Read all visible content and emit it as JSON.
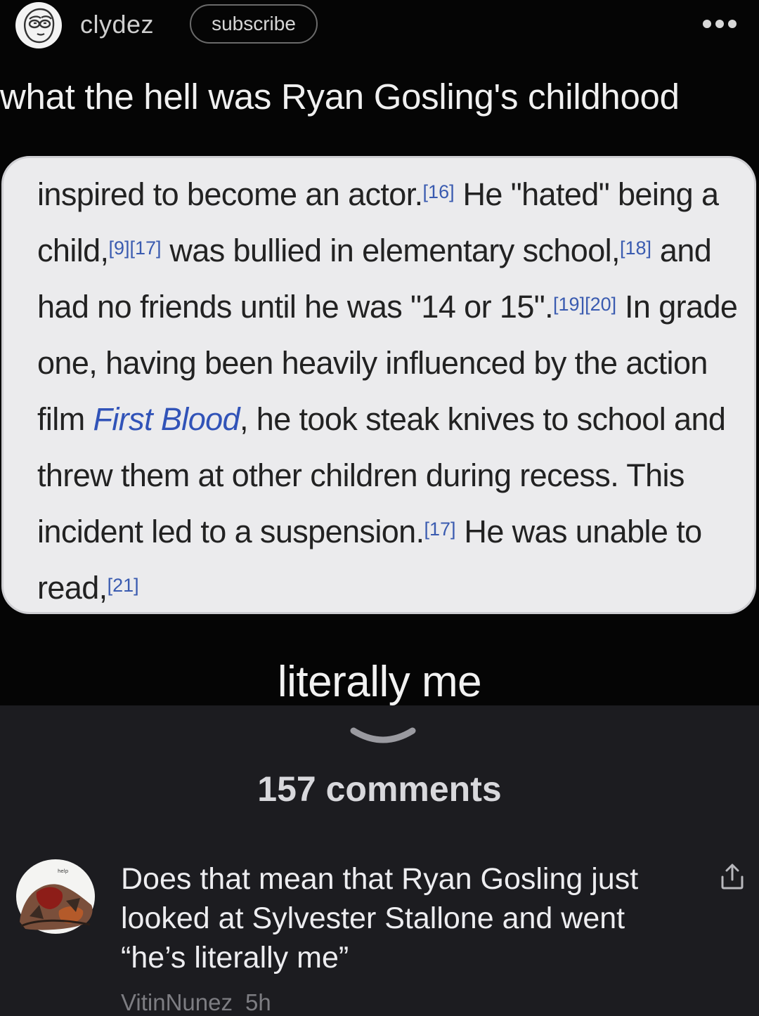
{
  "header": {
    "username": "clydez",
    "subscribe_label": "subscribe",
    "more_icon": "ellipsis-icon"
  },
  "post": {
    "title": "what the hell was Ryan Gosling's childhood",
    "wiki_excerpt": {
      "s1": "inspired to become an actor.",
      "c16": "[16]",
      "s2": " He \"hated\" being a child,",
      "c9_17": "[9][17]",
      "s3": " was bullied in elementary school,",
      "c18": "[18]",
      "s4": " and had no friends until he was \"14 or 15\".",
      "c19_20": "[19][20]",
      "s5": " In grade one, having been heavily influenced by the action film ",
      "link": "First Blood",
      "s6": ", he took steak knives to school and threw them at other children during recess. This incident led to a suspension.",
      "c17": "[17]",
      "s7": " He was unable to read,",
      "c21": "[21]"
    },
    "caption": "literally me"
  },
  "comments_section": {
    "count_label": "157 comments",
    "expand_icon": "chevron-down-icon"
  },
  "comment": {
    "text": "Does that mean that Ryan Gosling just looked at Sylvester Stallone and went “he’s literally me”",
    "author": "VitinNunez",
    "age": "5h",
    "avatar_label": "help",
    "share_icon": "share-icon"
  },
  "colors": {
    "meme_bg": "#050505",
    "page_bg": "#1c1c20",
    "card_bg": "#ebebed",
    "link": "#3153b8"
  }
}
